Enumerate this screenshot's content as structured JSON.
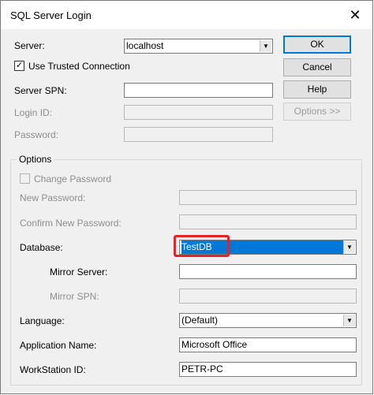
{
  "window": {
    "title": "SQL Server Login",
    "close_glyph": "✕"
  },
  "buttons": {
    "ok": "OK",
    "cancel": "Cancel",
    "help": "Help",
    "options": "Options >>"
  },
  "fields": {
    "server": {
      "label": "Server:",
      "value": "localhost"
    },
    "trusted": {
      "label": "Use Trusted Connection",
      "checked": true
    },
    "server_spn": {
      "label": "Server SPN:",
      "value": ""
    },
    "login_id": {
      "label": "Login ID:",
      "value": ""
    },
    "password": {
      "label": "Password:",
      "value": ""
    }
  },
  "options": {
    "title": "Options",
    "change_password": {
      "label": "Change Password",
      "checked": false
    },
    "new_password": {
      "label": "New Password:",
      "value": ""
    },
    "confirm_password": {
      "label": "Confirm New Password:",
      "value": ""
    },
    "database": {
      "label": "Database:",
      "value": "TestDB"
    },
    "mirror_server": {
      "label": "Mirror Server:",
      "value": ""
    },
    "mirror_spn": {
      "label": "Mirror SPN:",
      "value": ""
    },
    "language": {
      "label": "Language:",
      "value": "(Default)"
    },
    "application_name": {
      "label": "Application Name:",
      "value": "Microsoft Office"
    },
    "workstation_id": {
      "label": "WorkStation ID:",
      "value": "PETR-PC"
    }
  },
  "icons": {
    "dropdown": "▼",
    "check": "✓"
  },
  "colors": {
    "selection": "#0078d7",
    "highlight_box": "#e8202a",
    "default_button_border": "#0078d7"
  }
}
